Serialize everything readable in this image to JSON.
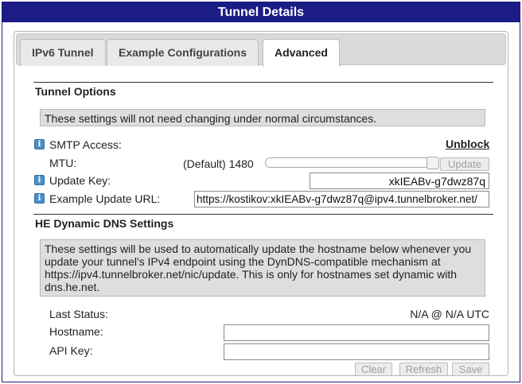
{
  "window": {
    "title": "Tunnel Details"
  },
  "tabs": [
    {
      "label": "IPv6 Tunnel"
    },
    {
      "label": "Example Configurations"
    },
    {
      "label": "Advanced"
    }
  ],
  "tunnel_options": {
    "title": "Tunnel Options",
    "note": "These settings will not need changing under normal circumstances.",
    "smtp_label": "SMTP Access:",
    "smtp_action": "Unblock",
    "mtu_label": "MTU:",
    "mtu_value": "(Default) 1480",
    "mtu_level_pct": 100,
    "update_button": "Update",
    "update_key_label": "Update Key:",
    "update_key_value": "xkIEABv-g7dwz87q",
    "example_url_label": "Example Update URL:",
    "example_url_value": "https://kostikov:xkIEABv-g7dwz87q@ipv4.tunnelbroker.net/"
  },
  "dns": {
    "title": "HE Dynamic DNS Settings",
    "note_lines": [
      "These settings will be used to automatically update the hostname below whenever you",
      "update your tunnel's IPv4 endpoint using the DynDNS-compatible mechanism at",
      "https://ipv4.tunnelbroker.net/nic/update. This is only for hostnames set dynamic with",
      "dns.he.net."
    ],
    "last_status_label": "Last Status:",
    "last_status_value": "N/A @ N/A UTC",
    "hostname_label": "Hostname:",
    "hostname_value": "",
    "api_key_label": "API Key:",
    "api_key_value": "",
    "clear_button": "Clear",
    "refresh_button": "Refresh",
    "save_button": "Save"
  },
  "colors": {
    "titlebar": "#1b1c86",
    "info_icon": "#4a8fc7",
    "note_background": "#dedede"
  },
  "icons": [
    "info-icon"
  ]
}
